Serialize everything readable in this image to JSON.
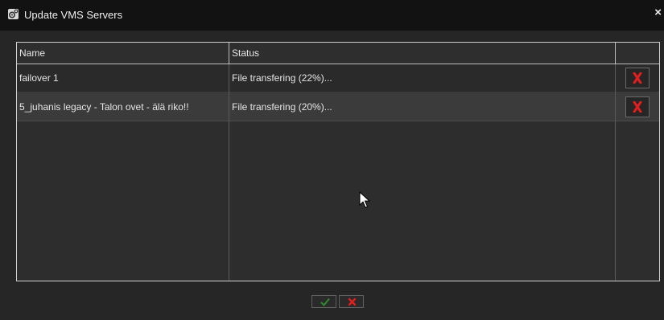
{
  "window": {
    "title": "Update VMS Servers",
    "close_glyph": "×"
  },
  "table": {
    "columns": [
      "Name",
      "Status",
      ""
    ],
    "rows": [
      {
        "name": "failover 1",
        "status": "File transfering (22%)...",
        "progress_percent": 22
      },
      {
        "name": "5_juhanis legacy - Talon ovet - älä riko!!",
        "status": "File transfering (20%)...",
        "progress_percent": 20
      }
    ]
  },
  "icons": {
    "app": "settings-gears-icon",
    "row_action": "red-x-remove-icon",
    "ok": "green-check-icon",
    "cancel": "red-x-icon"
  },
  "colors": {
    "background": "#262626",
    "titlebar": "#121212",
    "selected_row": "#3b3b3b",
    "remove_red": "#e01e1e",
    "ok_green": "#2e8b2e"
  }
}
